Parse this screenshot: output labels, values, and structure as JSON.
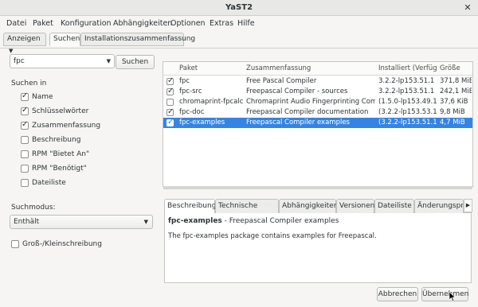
{
  "window": {
    "title": "YaST2"
  },
  "menu": [
    "Datei",
    "Paket",
    "Konfiguration",
    "Abhängigkeiten",
    "Optionen",
    "Extras",
    "Hilfe"
  ],
  "tabs": {
    "view_label": "Anzeigen",
    "search_label": "Suchen",
    "install_summary_label": "Installationszusammenfassung"
  },
  "search": {
    "value": "fpc",
    "button_label": "Suchen",
    "search_in_label": "Suchen in",
    "options": [
      {
        "label": "Name",
        "checked": true
      },
      {
        "label": "Schlüsselwörter",
        "checked": true
      },
      {
        "label": "Zusammenfassung",
        "checked": true
      },
      {
        "label": "Beschreibung",
        "checked": false
      },
      {
        "label": "RPM \"Bietet An\"",
        "checked": false
      },
      {
        "label": "RPM \"Benötigt\"",
        "checked": false
      },
      {
        "label": "Dateiliste",
        "checked": false
      }
    ],
    "mode_label": "Suchmodus:",
    "mode_value": "Enthält",
    "case_label": "Groß-/Kleinschreibung"
  },
  "table": {
    "columns": [
      "Paket",
      "Zusammenfassung",
      "Installiert (Verfüg",
      "Größe"
    ],
    "rows": [
      {
        "checked": true,
        "package": "fpc",
        "summary": "Free Pascal Compiler",
        "installed": "3.2.2-lp153.51.1",
        "size": "371,8 MiB",
        "selected": false
      },
      {
        "checked": true,
        "package": "fpc-src",
        "summary": "Freepascal Compiler - sources",
        "installed": "3.2.2-lp153.51.1",
        "size": "242,1 MiB",
        "selected": false
      },
      {
        "checked": false,
        "package": "chromaprint-fpcalc",
        "summary": "Chromaprint Audio Fingerprinting Com...",
        "installed": "(1.5.0-lp153.49.1)",
        "size": "37,6 KiB",
        "selected": false
      },
      {
        "checked": true,
        "package": "fpc-doc",
        "summary": "Freepascal Compiler documentation",
        "installed": "(3.2.2-lp153.53.1)",
        "size": "9,8 MiB",
        "selected": false
      },
      {
        "checked": true,
        "package": "fpc-examples",
        "summary": "Freepascal Compiler examples",
        "installed": "(3.2.2-lp153.51.1)",
        "size": "4,7 MiB",
        "selected": true
      }
    ]
  },
  "details": {
    "tabs": [
      "Beschreibung",
      "Technische Daten",
      "Abhängigkeiten",
      "Versionen",
      "Dateiliste",
      "Änderungspr"
    ],
    "title_name": "fpc-examples",
    "title_rest": " - Freepascal Compiler examples",
    "body": "The fpc-examples package contains examples for Freepascal."
  },
  "buttons": {
    "cancel": "Abbrechen",
    "apply": "Übernehmen"
  },
  "colors": {
    "selection": "#3584e4",
    "window_bg": "#f6f5f4"
  }
}
